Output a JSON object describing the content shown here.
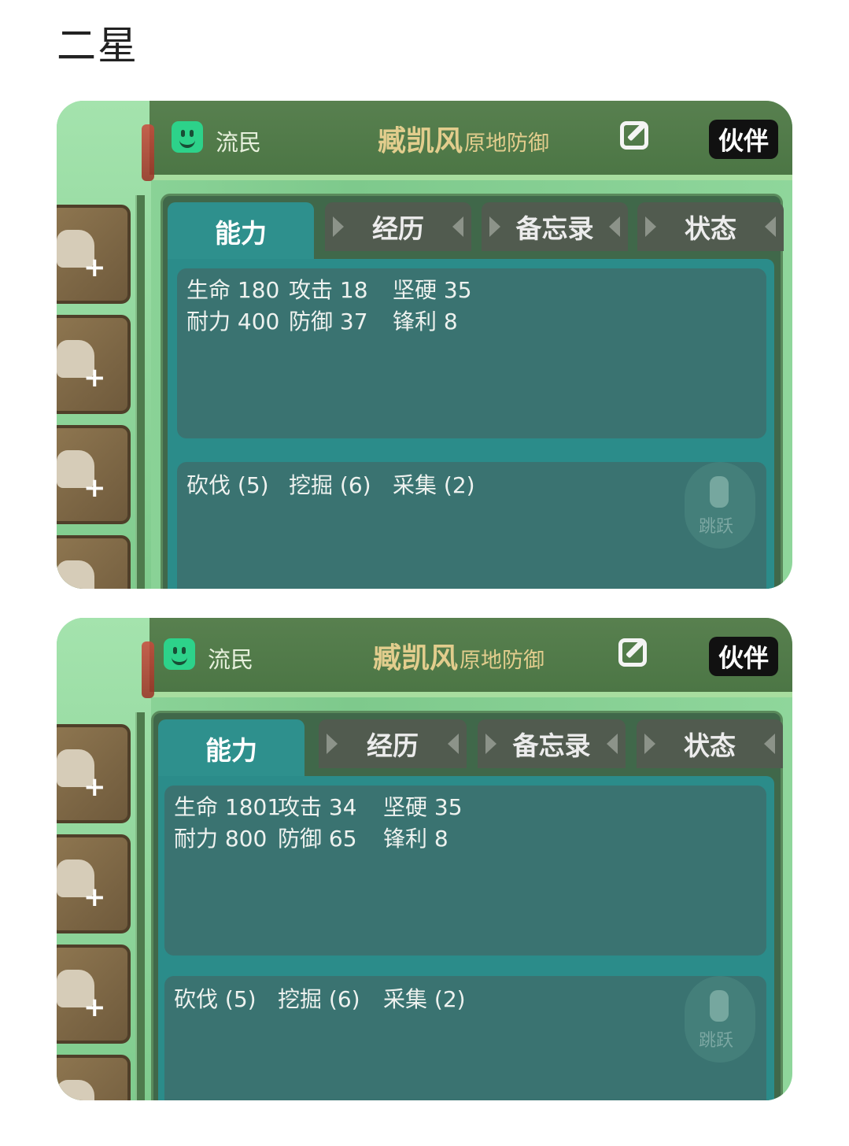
{
  "heading": "二星",
  "cards": [
    {
      "class_label": "流民",
      "name": "臧凯风",
      "mode": "原地防御",
      "partner_label": "伙伴",
      "tabs": [
        "能力",
        "经历",
        "备忘录",
        "状态"
      ],
      "stats_line1": [
        "生命 180",
        "攻击 18",
        "坚硬 35"
      ],
      "stats_line2": [
        "耐力 400",
        "防御 37",
        "锋利 8"
      ],
      "skills": [
        "砍伐 (5)",
        "挖掘 (6)",
        "采集 (2)"
      ],
      "jump_label": "跳跃"
    },
    {
      "class_label": "流民",
      "name": "臧凯风",
      "mode": "原地防御",
      "partner_label": "伙伴",
      "tabs": [
        "能力",
        "经历",
        "备忘录",
        "状态"
      ],
      "stats_line1": [
        "生命 1801",
        "攻击 34",
        "坚硬 35"
      ],
      "stats_line2": [
        "耐力 800",
        "防御 65",
        "锋利 8"
      ],
      "skills": [
        "砍伐 (5)",
        "挖掘 (6)",
        "采集 (2)"
      ],
      "jump_label": "跳跃"
    }
  ],
  "colors": {
    "accent_tab": "#2e908d",
    "name_gold": "#e2cd8d",
    "panel_green": "#40684a"
  },
  "icons": [
    "smiley-face-icon",
    "edit-icon",
    "equipment-slot-icon",
    "jump-icon"
  ]
}
